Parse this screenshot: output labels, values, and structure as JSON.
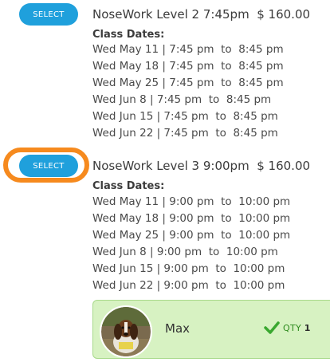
{
  "classes": [
    {
      "button_label": "SELECT",
      "title": "NoseWork Level 2 7:45pm",
      "price": "$ 160.00",
      "dates_heading": "Class Dates:",
      "dates": [
        "Wed May 11 | 7:45 pm  to  8:45 pm",
        "Wed May 18 | 7:45 pm  to  8:45 pm",
        "Wed May 25 | 7:45 pm  to  8:45 pm",
        "Wed Jun 8 | 7:45 pm  to  8:45 pm",
        "Wed Jun 15 | 7:45 pm  to  8:45 pm",
        "Wed Jun 22 | 7:45 pm  to  8:45 pm"
      ]
    },
    {
      "button_label": "SELECT",
      "title": "NoseWork Level 3 9:00pm",
      "price": "$ 160.00",
      "dates_heading": "Class Dates:",
      "dates": [
        "Wed May 11 | 9:00 pm  to  10:00 pm",
        "Wed May 18 | 9:00 pm  to  10:00 pm",
        "Wed May 25 | 9:00 pm  to  10:00 pm",
        "Wed Jun 8 | 9:00 pm  to  10:00 pm",
        "Wed Jun 15 | 9:00 pm  to  10:00 pm",
        "Wed Jun 22 | 9:00 pm  to  10:00 pm"
      ]
    }
  ],
  "selected_pet": {
    "name": "Max",
    "qty_label": "QTY",
    "qty_value": "1",
    "avatar_icon": "dog-photo",
    "status_icon": "checkmark-icon"
  },
  "colors": {
    "accent": "#1fa0dc",
    "highlight": "#f68a1e",
    "selected_bg": "#d7f2c2",
    "check": "#3aa830"
  }
}
